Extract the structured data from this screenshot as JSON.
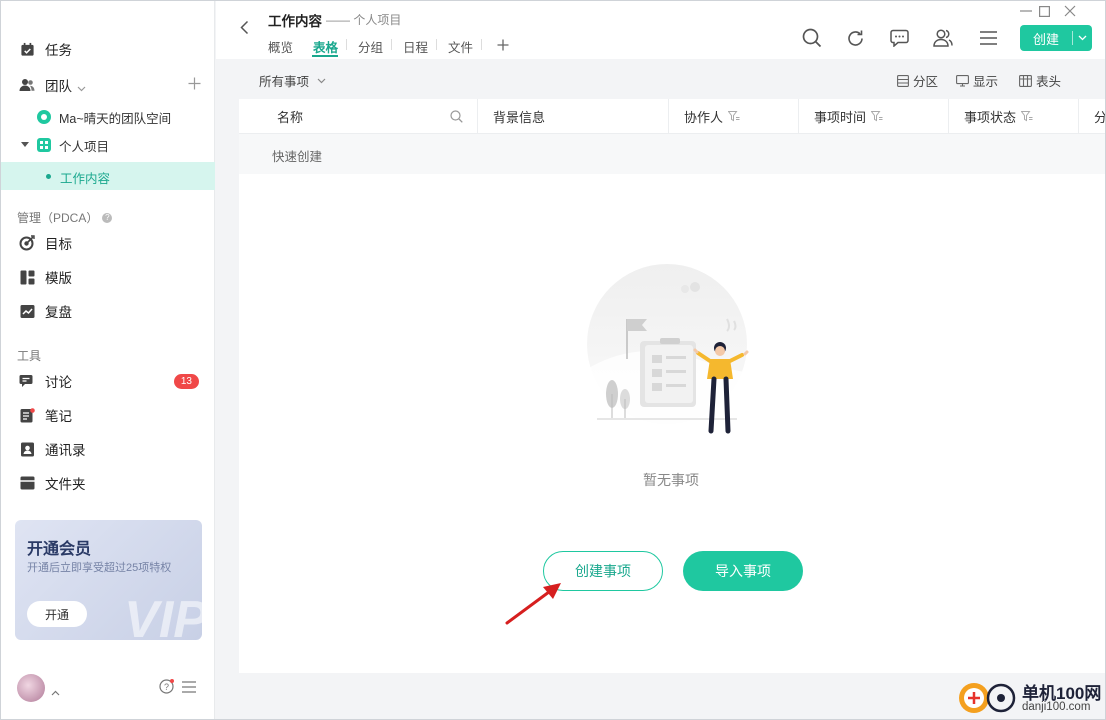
{
  "sidebar": {
    "tasks_label": "任务",
    "team_label": "团队",
    "team_space_label": "Ma~晴天的团队空间",
    "personal_project_label": "个人项目",
    "work_content_label": "工作内容",
    "pdca_title": "管理（PDCA）",
    "goals_label": "目标",
    "templates_label": "模版",
    "review_label": "复盘",
    "tools_title": "工具",
    "discuss_label": "讨论",
    "discuss_badge": "13",
    "notes_label": "笔记",
    "contacts_label": "通讯录",
    "folder_label": "文件夹"
  },
  "vip": {
    "title": "开通会员",
    "subtitle": "开通后立即享受超过25项特权",
    "button": "开通",
    "watermark": "VIP"
  },
  "header": {
    "title": "工作内容",
    "subtitle": "—— 个人项目",
    "tabs": [
      "概览",
      "表格",
      "分组",
      "日程",
      "文件"
    ],
    "create_label": "创建"
  },
  "filters": {
    "all_items": "所有事项",
    "partition": "分区",
    "display": "显示",
    "header": "表头"
  },
  "table": {
    "columns": [
      "名称",
      "背景信息",
      "协作人",
      "事项时间",
      "事项状态",
      "分"
    ],
    "quick_create": "快速创建",
    "empty_text": "暂无事项",
    "create_item": "创建事项",
    "import_item": "导入事项"
  },
  "watermark": {
    "brand": "单机100网",
    "url": "danji100.com"
  },
  "colors": {
    "accent": "#1fc8a0",
    "accent_text": "#1aa88e",
    "active_bg": "#d6f5ee",
    "badge": "#f04848"
  }
}
